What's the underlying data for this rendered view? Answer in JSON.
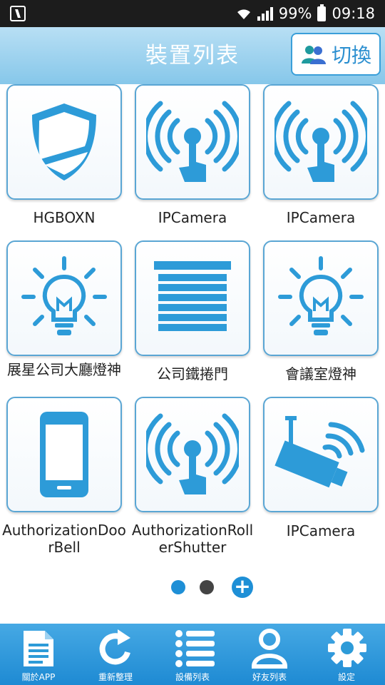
{
  "status_bar": {
    "battery": "99%",
    "time": "09:18"
  },
  "header": {
    "title": "裝置列表",
    "switch_label": "切換"
  },
  "devices": [
    {
      "label": "HGBOXN",
      "icon": "shield-icon"
    },
    {
      "label": "IPCamera",
      "icon": "wireless-signal-icon"
    },
    {
      "label": "IPCamera",
      "icon": "wireless-signal-icon"
    },
    {
      "label": "展星公司大廳燈神",
      "icon": "light-bulb-icon"
    },
    {
      "label": "公司鐵捲門",
      "icon": "roller-shutter-icon"
    },
    {
      "label": "會議室燈神",
      "icon": "light-bulb-icon"
    },
    {
      "label": "AuthorizationDoorBell",
      "icon": "phone-icon"
    },
    {
      "label": "AuthorizationRollerShutter",
      "icon": "wireless-signal-icon"
    },
    {
      "label": "IPCamera",
      "icon": "security-camera-icon"
    }
  ],
  "pager": {
    "pages": 2,
    "active_page": 1,
    "active_color": "#1e8fd6",
    "inactive_color": "#444444"
  },
  "bottom_nav": [
    {
      "label": "關於APP",
      "icon": "document-icon"
    },
    {
      "label": "重新整理",
      "icon": "refresh-icon"
    },
    {
      "label": "設備列表",
      "icon": "list-icon"
    },
    {
      "label": "好友列表",
      "icon": "user-icon"
    },
    {
      "label": "設定",
      "icon": "gear-icon"
    }
  ],
  "colors": {
    "accent": "#1e8fd6",
    "icon_blue": "#2d9bd8",
    "header_top": "#b8dff4",
    "header_bottom": "#86c7ea"
  }
}
